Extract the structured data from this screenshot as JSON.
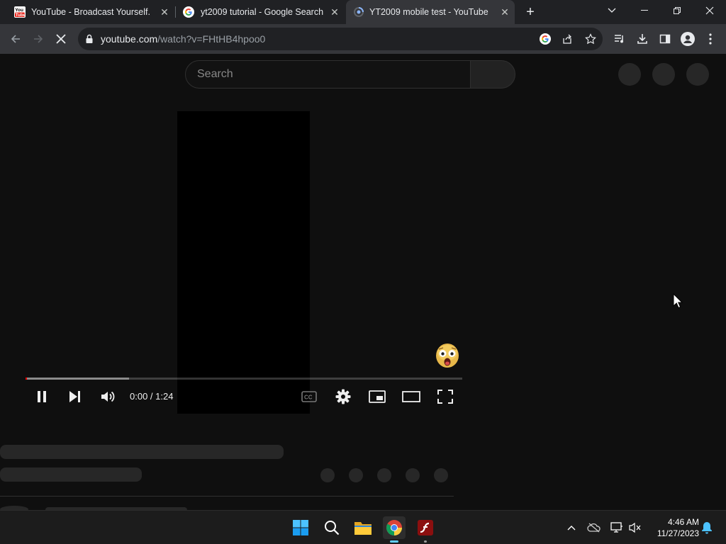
{
  "browser": {
    "tabs": [
      {
        "title": "YouTube - Broadcast Yourself.",
        "active": false,
        "favicon": "youtube-logo-icon"
      },
      {
        "title": "yt2009 tutorial - Google Search",
        "active": false,
        "favicon": "google-g-icon"
      },
      {
        "title": "YT2009 mobile test - YouTube",
        "active": true,
        "favicon": "loading-spinner-icon"
      }
    ],
    "address": {
      "host": "youtube.com",
      "path": "/watch?v=FHtHB4hpoo0"
    }
  },
  "page": {
    "search_placeholder": "Search"
  },
  "player": {
    "time": "0:00 / 1:24",
    "progress_played_fraction": 0.003,
    "progress_loaded_fraction": 0.237
  },
  "taskbar": {
    "time": "4:46 AM",
    "date": "11/27/2023"
  }
}
